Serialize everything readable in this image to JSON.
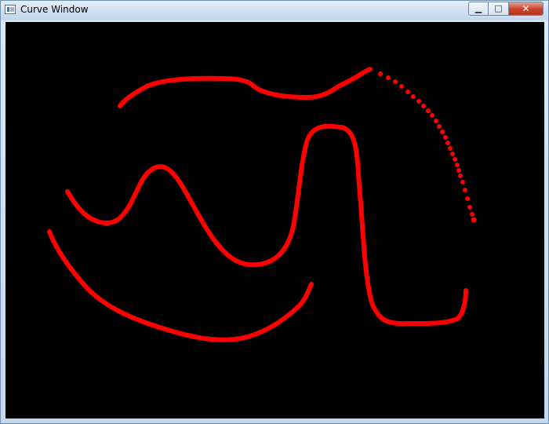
{
  "window": {
    "title": "Curve Window",
    "controls": {
      "minimize_glyph": "▁",
      "maximize_glyph": "□",
      "close_glyph": "✕"
    },
    "canvas_background": "#000000",
    "curve_color": "#ff0000"
  }
}
